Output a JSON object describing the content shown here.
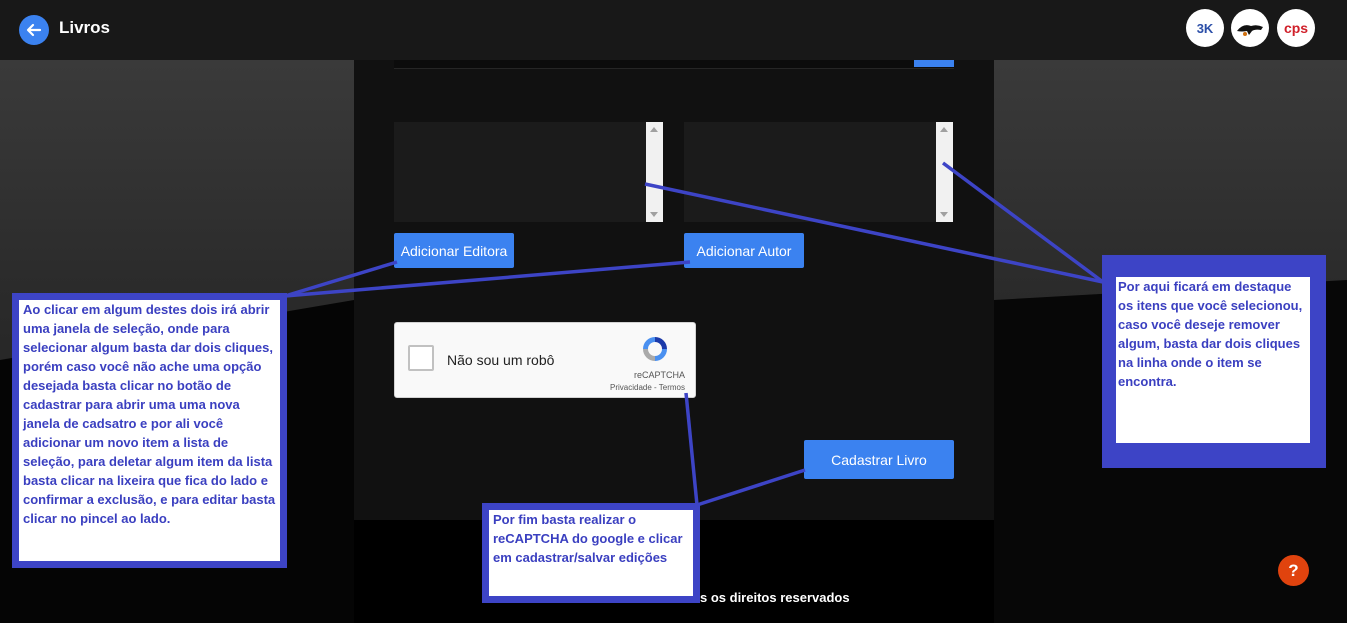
{
  "header": {
    "title": "Livros",
    "logos": [
      "3K",
      "",
      "cps"
    ]
  },
  "form": {
    "add_publisher_label": "Adicionar Editora",
    "add_author_label": "Adicionar Autor",
    "submit_label": "Cadastrar Livro"
  },
  "captcha": {
    "label": "Não sou um robô",
    "brand": "reCAPTCHA",
    "links": "Privacidade - Termos"
  },
  "notes": {
    "left": "Ao clicar em algum destes dois irá abrir uma janela de seleção, onde para selecionar algum basta dar dois cliques, porém caso você não ache uma opção desejada basta clicar no botão de cadastrar para abrir uma uma nova janela de cadsatro e por ali você adicionar um novo item a lista de seleção, para deletar algum item da lista basta clicar na lixeira que fica do lado e confirmar a exclusão, e para editar basta clicar no pincel ao lado.",
    "right": "Por aqui ficará em destaque os itens que você selecionou, caso você deseje remover algum, basta dar dois cliques na linha onde o item se encontra.",
    "bottom": "Por fim basta realizar o reCAPTCHA do google e clicar em cadastrar/salvar edições"
  },
  "footer": {
    "text": "s os direitos reservados"
  },
  "help": {
    "label": "?"
  },
  "colors": {
    "accent": "#3b82f0",
    "annotation": "#3d44c6",
    "help": "#e0430e"
  }
}
